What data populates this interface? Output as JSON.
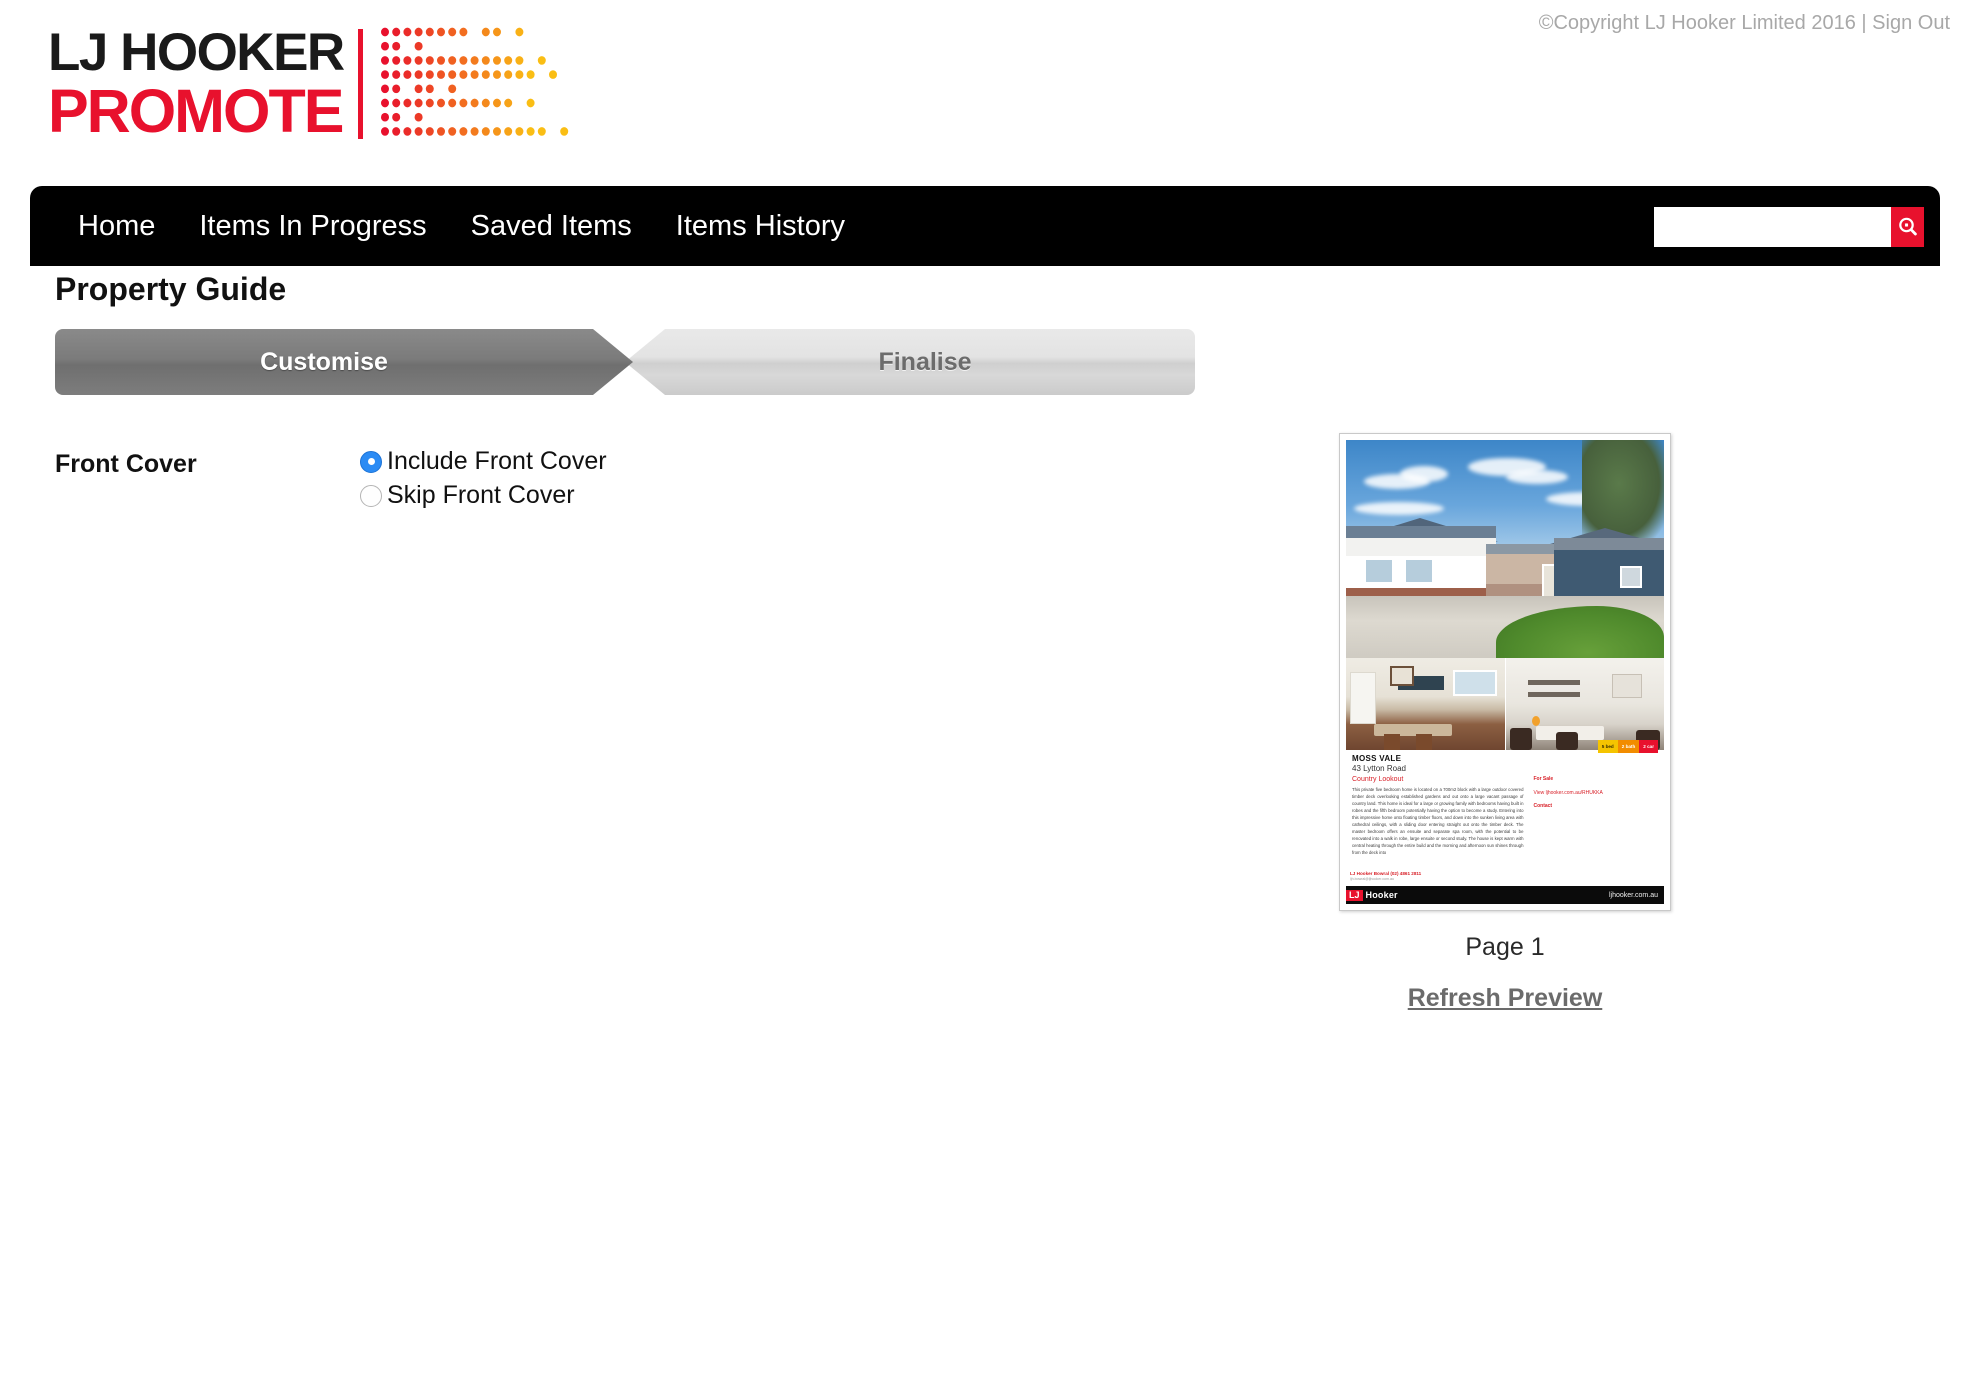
{
  "header": {
    "logo_line1": "LJ HOOKER",
    "logo_line2": "PROMOTE",
    "copyright": "©Copyright LJ Hooker Limited 2016",
    "separator": "|",
    "sign_out": "Sign Out"
  },
  "nav": {
    "items": [
      {
        "label": "Home"
      },
      {
        "label": "Items In Progress"
      },
      {
        "label": "Saved Items"
      },
      {
        "label": "Items History"
      }
    ],
    "search": {
      "value": "",
      "placeholder": "",
      "icon": "search-icon"
    }
  },
  "main": {
    "page_title": "Property Guide",
    "wizard": [
      {
        "label": "Customise",
        "active": true
      },
      {
        "label": "Finalise",
        "active": false
      }
    ],
    "form": {
      "section_label": "Front Cover",
      "options": [
        {
          "label": "Include Front Cover",
          "selected": true
        },
        {
          "label": "Skip Front Cover",
          "selected": false
        }
      ]
    }
  },
  "preview": {
    "page_number": "Page 1",
    "refresh_label": "Refresh Preview",
    "flyer": {
      "suburb": "MOSS VALE",
      "street": "43 Lytton Road",
      "tagline": "Country Lookout",
      "description": "This private five bedroom home is located on a 700m2 block with a large outdoor covered timber deck overlooking established gardens and out onto a large vacant passage of country land. This home is ideal for a large or growing family with bedrooms having built in robes and the fifth bedroom potentially having the option to become a study. Entering into this impressive home onto floating timber floors, and down into the sunken living area with cathedral ceilings, with a sliding door entering straight out onto the timber deck. The master bedroom offers an ensuite and separate spa room, with the potential to be renovated into a walk in robe, large ensuite or second study. The house is kept warm with central heating through the entire build and the morning and afternoon sun shines through from the deck into",
      "badges": [
        {
          "label": "5 bed",
          "color": "#f5c400"
        },
        {
          "label": "2 bath",
          "color": "#f28c00"
        },
        {
          "label": "2 car",
          "color": "#e8112d"
        }
      ],
      "for_sale": "For Sale",
      "view": "View ljhooker.com.au/RHUKKA",
      "contact": "Contact",
      "agency": "LJ Hooker Bowral (02) 4861 2811",
      "agency_sub": "ljh.bowral@ljhooker.com.au",
      "footer_logo_mark": "LJ",
      "footer_logo_text": "Hooker",
      "footer_url": "ljhooker.com.au"
    }
  },
  "colors": {
    "brand_red": "#e8112d",
    "nav_black": "#000000",
    "tab_active": "#7b7b7b",
    "tab_inactive": "#dcdcdc",
    "radio_blue": "#2b8bf4"
  }
}
